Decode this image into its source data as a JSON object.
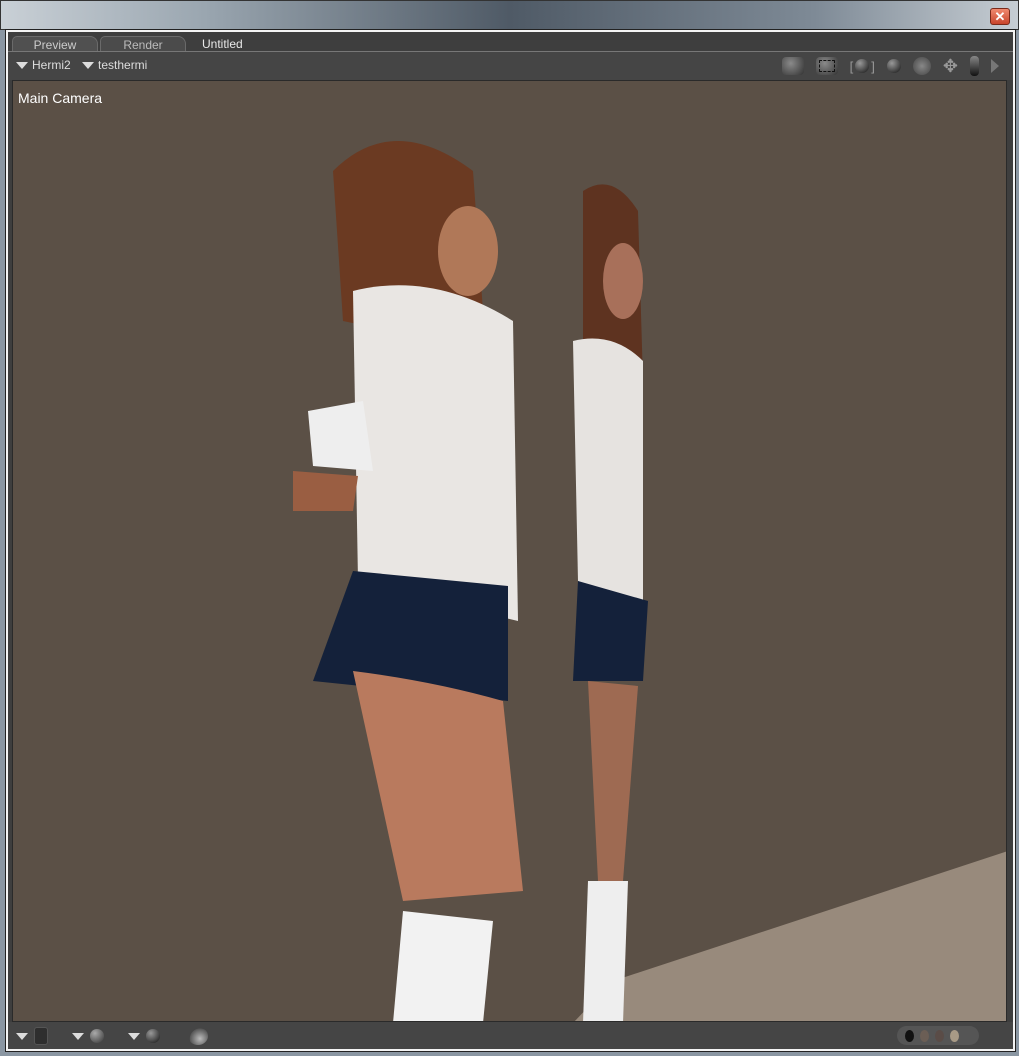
{
  "window": {
    "close_label": "✕"
  },
  "tabs": [
    {
      "label": "Preview",
      "active": true
    },
    {
      "label": "Render",
      "active": false
    }
  ],
  "document_title": "Untitled",
  "toolbar": {
    "figure_menu": "Hermi2",
    "actor_menu": "testhermi",
    "icons": [
      "main-camera-icon",
      "camera-dolly-icon",
      "bracket-sphere-icon",
      "sphere-icon",
      "trackball-icon",
      "move-xy-icon",
      "hand-icon",
      "more-arrow-icon"
    ]
  },
  "viewport": {
    "camera_label": "Main Camera",
    "background_color": "#5b5046"
  },
  "bottom_bar": {
    "icons": [
      "display-style-icon",
      "shading-icon",
      "lighting-icon",
      "multi-sphere-icon"
    ],
    "color_dots": [
      "#111111",
      "#6b5e55",
      "#5a4c47",
      "#a89a86"
    ]
  }
}
